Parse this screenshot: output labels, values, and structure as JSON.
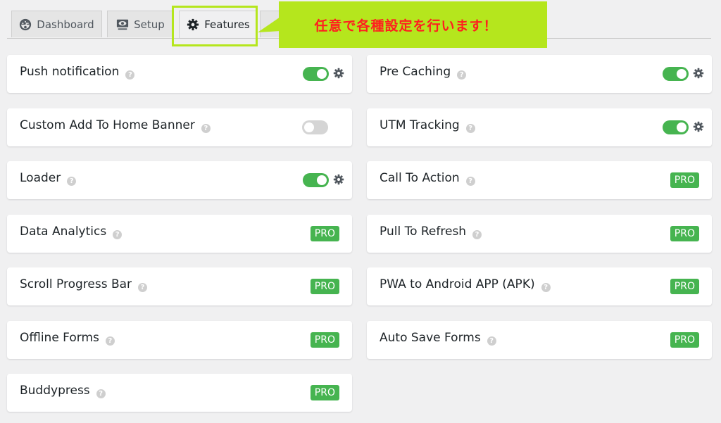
{
  "tabs": [
    {
      "label": "Dashboard",
      "icon": "dashboard-gauge-icon",
      "active": false
    },
    {
      "label": "Setup",
      "icon": "monitor-eye-icon",
      "active": false
    },
    {
      "label": "Features",
      "icon": "gear-icon",
      "active": true
    },
    {
      "label": "...",
      "icon": "",
      "active": false
    }
  ],
  "callout": {
    "text": "任意で各種設定を行います！",
    "background": "#b5e61d",
    "text_color": "#ff1f1f"
  },
  "colors": {
    "toggle_on": "#46b450",
    "toggle_off": "#d5d5d5",
    "pro_badge": "#46b450"
  },
  "features": {
    "left": [
      {
        "label": "Push notification",
        "control": "toggle",
        "enabled": true,
        "settings": true
      },
      {
        "label": "Custom Add To Home Banner",
        "control": "toggle",
        "enabled": false,
        "settings": false
      },
      {
        "label": "Loader",
        "control": "toggle",
        "enabled": true,
        "settings": true
      },
      {
        "label": "Data Analytics",
        "control": "pro",
        "badge": "PRO"
      },
      {
        "label": "Scroll Progress Bar",
        "control": "pro",
        "badge": "PRO"
      },
      {
        "label": "Offline Forms",
        "control": "pro",
        "badge": "PRO"
      },
      {
        "label": "Buddypress",
        "control": "pro",
        "badge": "PRO"
      }
    ],
    "right": [
      {
        "label": "Pre Caching",
        "control": "toggle",
        "enabled": true,
        "settings": true
      },
      {
        "label": "UTM Tracking",
        "control": "toggle",
        "enabled": true,
        "settings": true
      },
      {
        "label": "Call To Action",
        "control": "pro",
        "badge": "PRO"
      },
      {
        "label": "Pull To Refresh",
        "control": "pro",
        "badge": "PRO"
      },
      {
        "label": "PWA to Android APP (APK)",
        "control": "pro",
        "badge": "PRO"
      },
      {
        "label": "Auto Save Forms",
        "control": "pro",
        "badge": "PRO"
      }
    ]
  },
  "help_glyph": "?"
}
